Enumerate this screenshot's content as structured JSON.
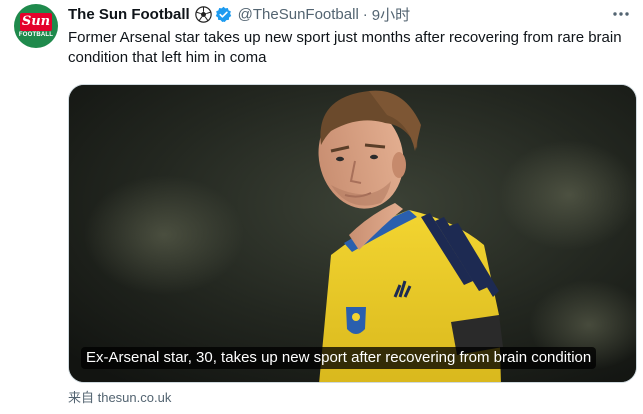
{
  "tweet": {
    "avatar": {
      "brand_text": "Sun",
      "sub_text": "FOOTBALL",
      "brand_color": "#e4002b",
      "bg_color": "#1f8a4c"
    },
    "account_name": "The Sun Football",
    "account_emoji_icon": "soccer-ball-icon",
    "verified_icon": "verified-badge-icon",
    "handle": "@TheSunFootball",
    "separator": "·",
    "time": "9小时",
    "more_icon": "more-options-icon",
    "text": "Former Arsenal star takes up new sport just months after recovering from rare brain condition that left him in coma",
    "card": {
      "caption": "Ex-Arsenal star, 30, takes up new sport after recovering from brain condition",
      "image_subject": "footballer-in-sweden-kit-photo"
    },
    "source_label": "来自 thesun.co.uk"
  }
}
